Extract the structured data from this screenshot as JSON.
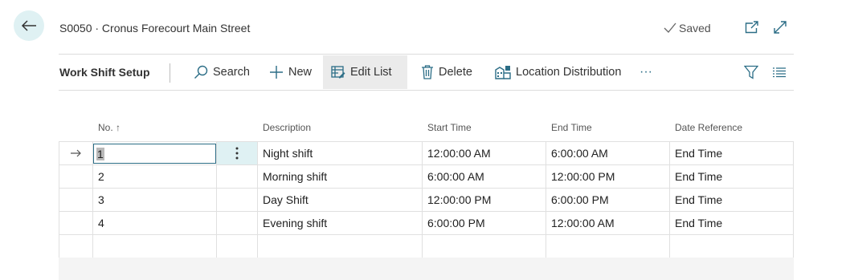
{
  "header": {
    "title": "S0050 · Cronus Forecourt Main Street",
    "saved_label": "Saved"
  },
  "toolbar": {
    "page_name": "Work Shift Setup",
    "search_label": "Search",
    "new_label": "New",
    "edit_list_label": "Edit List",
    "delete_label": "Delete",
    "location_distribution_label": "Location Distribution",
    "more_label": "···"
  },
  "columns": {
    "no": "No. ↑",
    "description": "Description",
    "start_time": "Start Time",
    "end_time": "End Time",
    "date_reference": "Date Reference"
  },
  "rows": [
    {
      "no": "1",
      "description": "Night shift",
      "start_time": "12:00:00 AM",
      "end_time": "6:00:00 AM",
      "date_reference": "End Time"
    },
    {
      "no": "2",
      "description": "Morning shift",
      "start_time": "6:00:00 AM",
      "end_time": "12:00:00 PM",
      "date_reference": "End Time"
    },
    {
      "no": "3",
      "description": "Day Shift",
      "start_time": "12:00:00 PM",
      "end_time": "6:00:00 PM",
      "date_reference": "End Time"
    },
    {
      "no": "4",
      "description": "Evening shift",
      "start_time": "6:00:00 PM",
      "end_time": "12:00:00 AM",
      "date_reference": "End Time"
    }
  ],
  "colors": {
    "accent": "#2b6d86",
    "back_button_bg": "#dff1f3",
    "active_toolbar_bg": "#ebebeb"
  },
  "icons": {
    "back": "arrow-left-icon",
    "saved": "checkmark-icon",
    "open_new": "open-in-new-window-icon",
    "expand": "expand-icon",
    "search": "search-icon",
    "new": "plus-icon",
    "edit_list": "edit-list-icon",
    "delete": "trash-icon",
    "location": "location-distribution-icon",
    "filter": "filter-icon",
    "list": "list-view-icon",
    "row_indicator": "arrow-right-icon",
    "row_menu": "vertical-dots-icon"
  }
}
